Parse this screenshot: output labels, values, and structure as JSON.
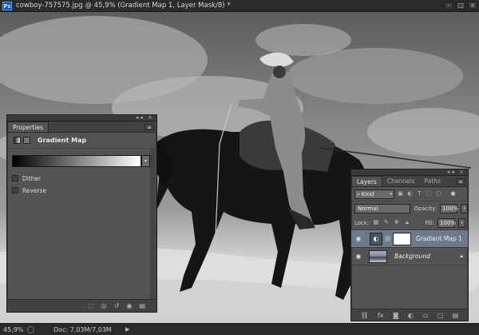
{
  "window": {
    "app_icon_label": "Ps",
    "title": "cowboy-757575.jpg @ 45,9% (Gradient Map 1, Layer Mask/8) *"
  },
  "status": {
    "zoom": "45,9%",
    "doc_info": "Doc: 7,03M/7,03M"
  },
  "properties": {
    "tab_label": "Properties",
    "header_title": "Gradient Map",
    "dither_label": "Dither",
    "reverse_label": "Reverse",
    "icons": [
      "gradient-map-icon",
      "layer-mask-icon",
      "clip-to-layer-icon",
      "view-previous-icon",
      "reset-icon",
      "visibility-icon",
      "trash-icon"
    ]
  },
  "layers": {
    "tabs": [
      {
        "label": "Layers",
        "active": true
      },
      {
        "label": "Channels",
        "active": false
      },
      {
        "label": "Paths",
        "active": false
      }
    ],
    "filter_kind": "Kind",
    "blend_mode": "Normal",
    "opacity_label": "Opacity:",
    "opacity_value": "100%",
    "lock_label": "Lock:",
    "fill_label": "Fill:",
    "fill_value": "100%",
    "rows": [
      {
        "name": "Gradient Map 1",
        "selected": true
      },
      {
        "name": "Background",
        "selected": false
      }
    ]
  },
  "colors": {
    "selected_row": "#6d7a8c",
    "panel_bg": "#535353"
  }
}
